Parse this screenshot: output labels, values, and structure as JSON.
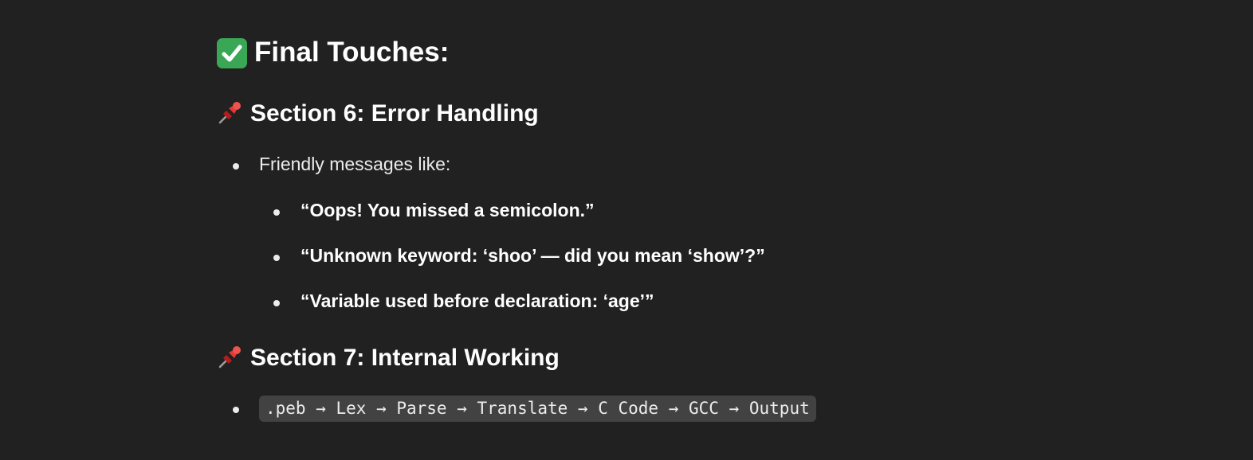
{
  "heading_main": {
    "icon": "check-mark-button-icon",
    "text": "Final Touches:"
  },
  "section6": {
    "icon": "pushpin-icon",
    "title": "Section 6: Error Handling",
    "item": "Friendly messages like:",
    "subitems": [
      "“Oops! You missed a semicolon.”",
      "“Unknown keyword: ‘shoo’ — did you mean ‘show’?”",
      "“Variable used before declaration: ‘age’”"
    ]
  },
  "section7": {
    "icon": "pushpin-icon",
    "title": "Section 7: Internal Working",
    "code": ".peb → Lex → Parse → Translate → C Code → GCC → Output"
  }
}
